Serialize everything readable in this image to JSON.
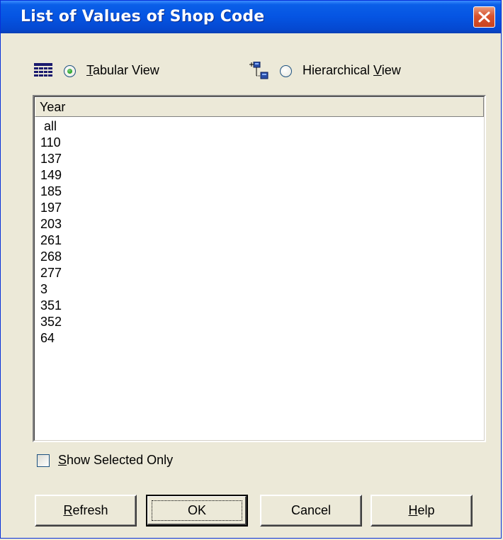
{
  "window": {
    "title": "List of Values of Shop Code"
  },
  "view": {
    "tabular_label_mnemonic": "T",
    "tabular_label_rest": "abular View",
    "tabular_selected": true,
    "hierarchical_label_prefix": "Hierarchical ",
    "hierarchical_label_mnemonic": "V",
    "hierarchical_label_rest": "iew",
    "hierarchical_selected": false
  },
  "list": {
    "column_header": "Year",
    "rows": [
      " all",
      "110",
      "137",
      "149",
      "185",
      "197",
      "203",
      "261",
      "268",
      "277",
      "3",
      "351",
      "352",
      "64"
    ]
  },
  "options": {
    "show_selected_mnemonic": "S",
    "show_selected_rest": "how Selected Only",
    "show_selected_checked": false
  },
  "buttons": {
    "refresh_mnemonic": "R",
    "refresh_rest": "efresh",
    "ok_label": "OK",
    "cancel_label": "Cancel",
    "help_mnemonic": "H",
    "help_rest": "elp"
  },
  "icons": {
    "tabular": "grid-table-icon",
    "hierarchical": "hierarchy-tree-icon",
    "close": "close-icon"
  },
  "colors": {
    "titlebar": "#0554e2",
    "close_button": "#d8542f",
    "dialog_bg": "#ece9d8",
    "radio_dot": "#21a121"
  }
}
